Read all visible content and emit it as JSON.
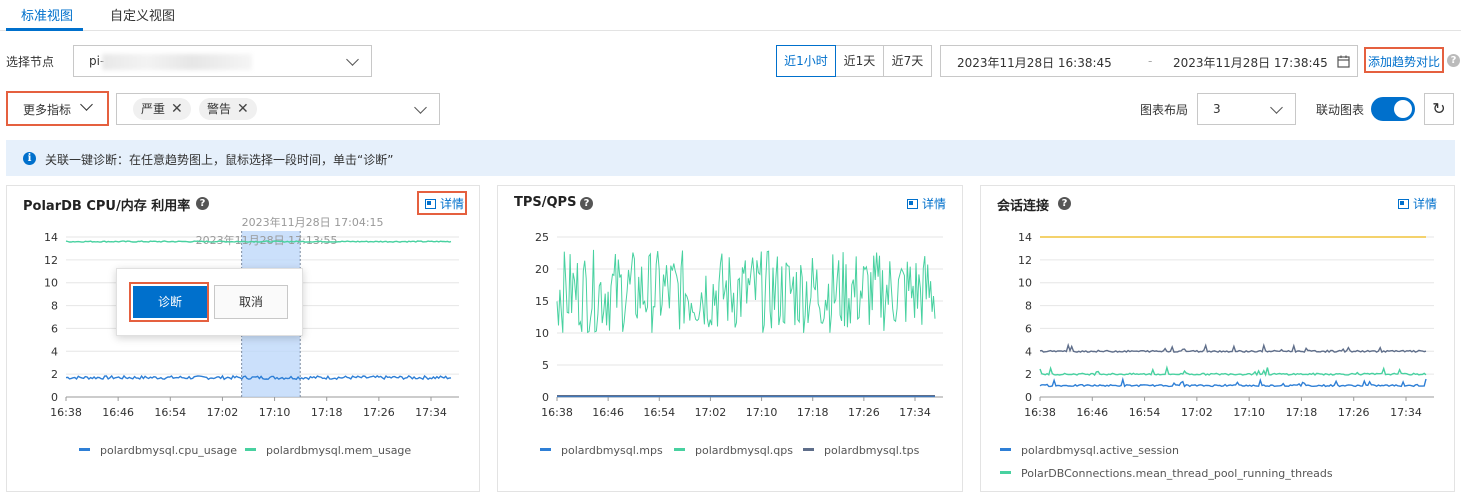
{
  "tabs": [
    {
      "label": "标准视图"
    },
    {
      "label": "自定义视图"
    }
  ],
  "node": {
    "label": "选择节点",
    "value": "pi-"
  },
  "time_ranges": [
    "近1小时",
    "近1天",
    "近7天"
  ],
  "date_range": {
    "start": "2023年11月28日 16:38:45",
    "sep": "-",
    "end": "2023年11月28日 17:38:45"
  },
  "compare_link": "添加趋势对比",
  "metrics": {
    "label": "更多指标",
    "tags": [
      "严重",
      "警告"
    ]
  },
  "layout": {
    "label": "图表布局",
    "value": "3"
  },
  "linked": {
    "label": "联动图表"
  },
  "info": {
    "text": "关联一键诊断：在任意趋势图上，鼠标选择一段时间，单击“诊断”"
  },
  "detail_label": "详情",
  "popup": {
    "ok": "诊断",
    "cancel": "取消"
  },
  "colors": {
    "accent": "#0070cc",
    "highlight": "#e5603f",
    "blue": "#2e7fd6",
    "green": "#48d1a0",
    "gray": "#5f6e8a",
    "yellow": "#f0c43c"
  },
  "chart_data": [
    {
      "type": "line",
      "title": "PolarDB CPU/内存 利用率",
      "x_ticks": [
        "16:38",
        "16:46",
        "16:54",
        "17:02",
        "17:10",
        "17:18",
        "17:26",
        "17:34"
      ],
      "ylim": [
        0,
        14
      ],
      "y_ticks": [
        "0",
        "2",
        "4",
        "6",
        "8",
        "10",
        "12",
        "14"
      ],
      "grid": true,
      "legend": "bottom",
      "series": [
        {
          "name": "polardbmysql.cpu_usage",
          "color": "#2e7fd6",
          "approx_value": 1.7,
          "noise": 0.3
        },
        {
          "name": "polardbmysql.mem_usage",
          "color": "#48d1a0",
          "approx_value": 13.6,
          "noise": 0.1
        }
      ],
      "selection": {
        "start": "2023年11月28日 17:04:15",
        "end": "2023年11月28日 17:13:55"
      }
    },
    {
      "type": "line",
      "title": "TPS/QPS",
      "x_ticks": [
        "16:38",
        "16:46",
        "16:54",
        "17:02",
        "17:10",
        "17:18",
        "17:26",
        "17:34"
      ],
      "ylim": [
        0,
        25
      ],
      "y_ticks": [
        "0",
        "5",
        "10",
        "15",
        "20",
        "25"
      ],
      "grid": true,
      "legend": "bottom",
      "series": [
        {
          "name": "polardbmysql.mps",
          "color": "#2e7fd6",
          "approx_value": 0.1,
          "noise": 0
        },
        {
          "name": "polardbmysql.qps",
          "color": "#48d1a0",
          "approx_value": 16.5,
          "noise": 6.5
        },
        {
          "name": "polardbmysql.tps",
          "color": "#5f6e8a",
          "approx_value": 0.2,
          "noise": 0
        }
      ]
    },
    {
      "type": "line",
      "title": "会话连接",
      "x_ticks": [
        "16:38",
        "16:46",
        "16:54",
        "17:02",
        "17:10",
        "17:18",
        "17:26",
        "17:34"
      ],
      "ylim": [
        0,
        14
      ],
      "y_ticks": [
        "0",
        "2",
        "4",
        "6",
        "8",
        "10",
        "12",
        "14"
      ],
      "grid": true,
      "legend": "bottom",
      "series": [
        {
          "name": "polardbmysql.active_session",
          "color": "#2e7fd6",
          "approx_value": 1,
          "noise": 0.4
        },
        {
          "name": "PolarDBConnections.mean_thread_pool_running_threads",
          "color": "#48d1a0",
          "approx_value": 2,
          "noise": 0.4
        },
        {
          "name": "",
          "color": "#5f6e8a",
          "approx_value": 4,
          "noise": 0.4
        },
        {
          "name": "",
          "color": "#f0c43c",
          "approx_value": 14,
          "noise": 0
        }
      ]
    }
  ]
}
